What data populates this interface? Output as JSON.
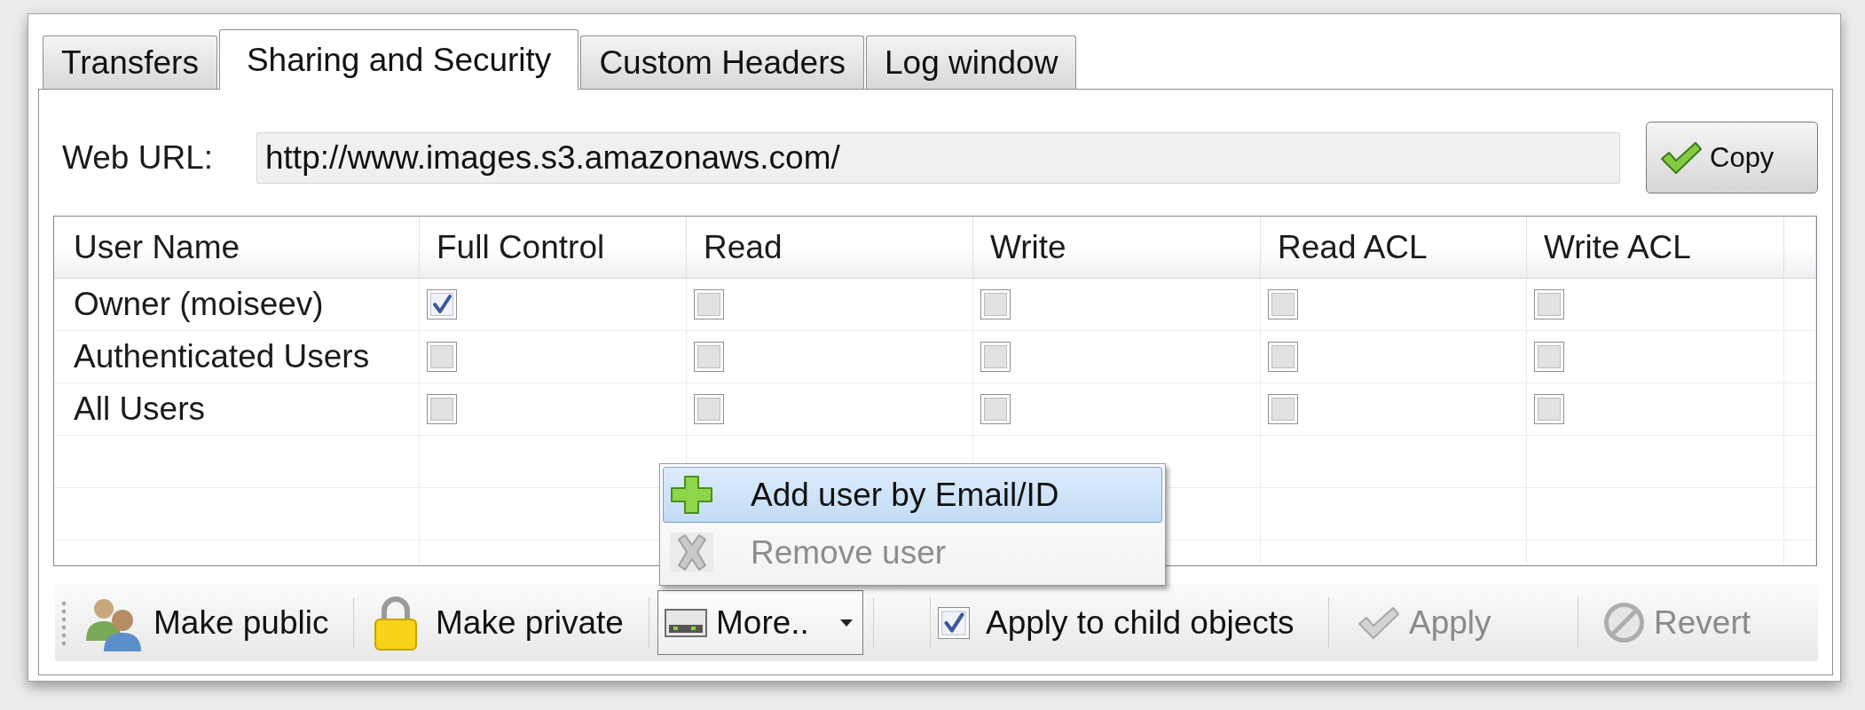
{
  "tabs": [
    {
      "label": "Transfers",
      "selected": false
    },
    {
      "label": "Sharing and Security",
      "selected": true
    },
    {
      "label": "Custom Headers",
      "selected": false
    },
    {
      "label": "Log window",
      "selected": false
    }
  ],
  "web_url": {
    "label": "Web URL:",
    "value": "http://www.images.s3.amazonaws.com/"
  },
  "copy_button": {
    "label": "Copy"
  },
  "permissions_table": {
    "columns": [
      "User Name",
      "Full Control",
      "Read",
      "Write",
      "Read ACL",
      "Write ACL"
    ],
    "rows": [
      {
        "user": "Owner (moiseev)",
        "permissions": [
          {
            "checked": true
          },
          {
            "checked": false
          },
          {
            "checked": false
          },
          {
            "checked": false
          },
          {
            "checked": false
          }
        ]
      },
      {
        "user": "Authenticated Users",
        "permissions": [
          {
            "checked": false
          },
          {
            "checked": false
          },
          {
            "checked": false
          },
          {
            "checked": false
          },
          {
            "checked": false
          }
        ]
      },
      {
        "user": "All Users",
        "permissions": [
          {
            "checked": false
          },
          {
            "checked": false
          },
          {
            "checked": false
          },
          {
            "checked": false
          },
          {
            "checked": false
          }
        ]
      }
    ]
  },
  "toolbar": {
    "make_public_button": {
      "label": "Make public"
    },
    "make_private_button": {
      "label": "Make private"
    },
    "more_button": {
      "label": "More..",
      "expanded": true
    },
    "apply_to_children": {
      "label": "Apply to child objects",
      "checked": true
    },
    "apply_button": {
      "label": "Apply",
      "disabled": true
    },
    "revert_button": {
      "label": "Revert",
      "disabled": true
    }
  },
  "more_menu": {
    "items": [
      {
        "label": "Add user by Email/ID",
        "selected": true,
        "disabled": false
      },
      {
        "label": "Remove user",
        "selected": false,
        "disabled": true
      }
    ]
  }
}
